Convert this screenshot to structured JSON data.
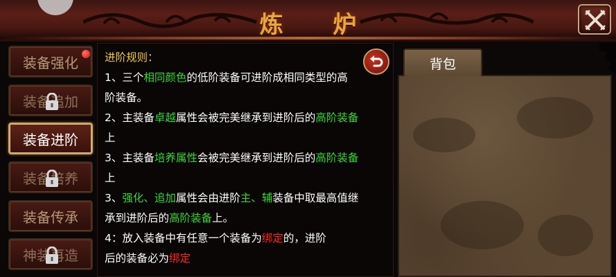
{
  "window": {
    "title": "炼 炉",
    "close_icon": "close-x-icon"
  },
  "sidebar": {
    "items": [
      {
        "label": "装备强化",
        "state": "normal",
        "badge": true
      },
      {
        "label": "装备追加",
        "state": "locked"
      },
      {
        "label": "装备进阶",
        "state": "active"
      },
      {
        "label": "装备培养",
        "state": "locked"
      },
      {
        "label": "装备传承",
        "state": "normal"
      },
      {
        "label": "神装再造",
        "state": "locked"
      }
    ]
  },
  "rules": {
    "heading": "进阶规则：",
    "l1a": "1、三个",
    "l1b": "相同颜色",
    "l1c": "的低阶装备可进阶成相同类型的高",
    "l2": "阶装备。",
    "l3a": "2、主装备",
    "l3b": "卓越",
    "l3c": "属性会被完美继承到进阶后的",
    "l3d": "高阶装备",
    "l4": "上",
    "l5a": "3、主装备",
    "l5b": "培养属性",
    "l5c": "会被完美继承到进阶后的",
    "l5d": "高阶装备",
    "l6": "上",
    "l7a": "3、",
    "l7b": "强化、追加",
    "l7c": "属性会由进阶",
    "l7d": "主、辅",
    "l7e": "装备中取最高值继",
    "l8a": "承到进阶后的",
    "l8b": "高阶装备",
    "l8c": "上。",
    "l9a": "4：放入装备中有任意一个装备为",
    "l9b": "绑定",
    "l9c": "的，进阶",
    "l10a": "后的装备必为",
    "l10b": "绑定"
  },
  "bag": {
    "tab_label": "背包"
  },
  "colors": {
    "title": "#e8a63c",
    "highlight_green": "#3bd83a",
    "highlight_red": "#ff2a2a",
    "heading_yellow": "#f2c94a"
  }
}
